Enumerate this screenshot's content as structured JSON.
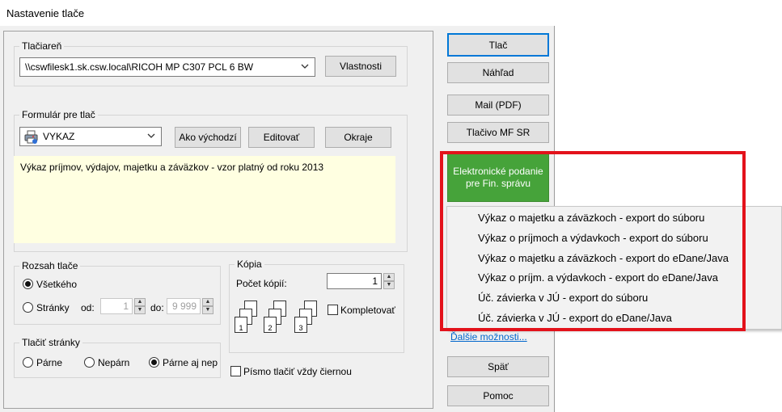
{
  "window": {
    "title": "Nastavenie tlače"
  },
  "printer": {
    "group_title": "Tlačiareň",
    "selected": "\\\\cswfilesk1.sk.csw.local\\RICOH MP C307 PCL 6 BW",
    "properties_label": "Vlastnosti"
  },
  "form": {
    "group_title": "Formulár pre tlač",
    "selected": "VYKAZ",
    "set_default_label": "Ako východzí",
    "edit_label": "Editovať",
    "margins_label": "Okraje",
    "description": "Výkaz príjmov, výdajov, majetku a záväzkov - vzor platný od roku 2013"
  },
  "range": {
    "group_title": "Rozsah tlače",
    "all_label": "Všetkého",
    "pages_label": "Stránky",
    "from_label": "od:",
    "from_value": "1",
    "to_label": "do:",
    "to_value": "9 999",
    "selected": "all"
  },
  "copies": {
    "group_title": "Kópia",
    "count_label": "Počet kópií:",
    "count_value": "1",
    "collate_label": "Kompletovať",
    "collate_checked": false
  },
  "print_pages": {
    "group_title": "Tlačiť stránky",
    "even_label": "Párne",
    "odd_label": "Nepárn",
    "both_label": "Párne aj nep",
    "selected": "both"
  },
  "black_font": {
    "label": "Písmo tlačiť vždy čiernou",
    "checked": false
  },
  "side_buttons": {
    "print": "Tlač",
    "preview": "Náhľad",
    "mail_pdf": "Mail (PDF)",
    "mf_form": "Tlačivo MF SR",
    "efin_line1": "Elektronické podanie",
    "efin_line2": "pre Fin. správu",
    "more_options": "Ďalšie možnosti...",
    "back": "Späť",
    "help": "Pomoc"
  },
  "efin_menu": [
    "Výkaz o majetku a záväzkoch - export do súboru",
    "Výkaz o príjmoch a výdavkoch - export do súboru",
    "Výkaz o majetku a záväzkoch - export do eDane/Java",
    "Výkaz o príjm. a výdavkoch - export do eDane/Java",
    "Úč. závierka v JÚ - export do súboru",
    "Úč. závierka v JÚ - export do eDane/Java"
  ],
  "colors": {
    "efin_button": "#46a33a",
    "highlight_frame": "#e3121b",
    "link": "#0066cc",
    "description_bg": "#ffffe1"
  }
}
